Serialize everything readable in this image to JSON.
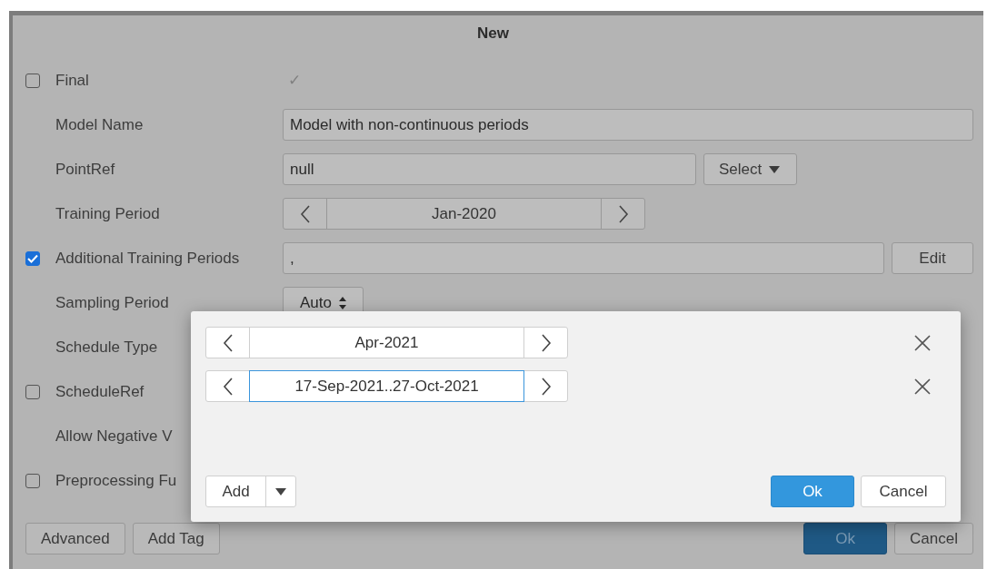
{
  "dialog": {
    "title": "New",
    "fields": [
      {
        "label": "Final",
        "checked": false,
        "kind": "tick",
        "value": "✓"
      },
      {
        "label": "Model Name",
        "kind": "text",
        "value": "Model with non-continuous periods"
      },
      {
        "label": "PointRef",
        "kind": "text_select",
        "value": "null",
        "button": "Select"
      },
      {
        "label": "Training Period",
        "kind": "stepper",
        "value": "Jan-2020"
      },
      {
        "label": "Additional Training Periods",
        "checked": true,
        "kind": "text_button",
        "value": ",",
        "button": "Edit"
      },
      {
        "label": "Sampling Period",
        "kind": "spinner",
        "value": "Auto"
      },
      {
        "label": "Schedule Type",
        "kind": "none"
      },
      {
        "label": "ScheduleRef",
        "checked": false,
        "kind": "none"
      },
      {
        "label": "Allow Negative V",
        "kind": "none"
      },
      {
        "label": "Preprocessing Fu",
        "checked": false,
        "kind": "none"
      }
    ],
    "left_buttons": [
      "Advanced",
      "Add Tag"
    ],
    "right_buttons": [
      {
        "label": "Ok",
        "kind": "primary"
      },
      {
        "label": "Cancel",
        "kind": "default"
      }
    ]
  },
  "popup": {
    "periods": [
      {
        "value": "Apr-2021",
        "focused": false
      },
      {
        "value": "17-Sep-2021..27-Oct-2021",
        "focused": true
      }
    ],
    "add_button": "Add",
    "buttons": [
      {
        "label": "Ok",
        "kind": "primary"
      },
      {
        "label": "Cancel",
        "kind": "default"
      }
    ]
  }
}
